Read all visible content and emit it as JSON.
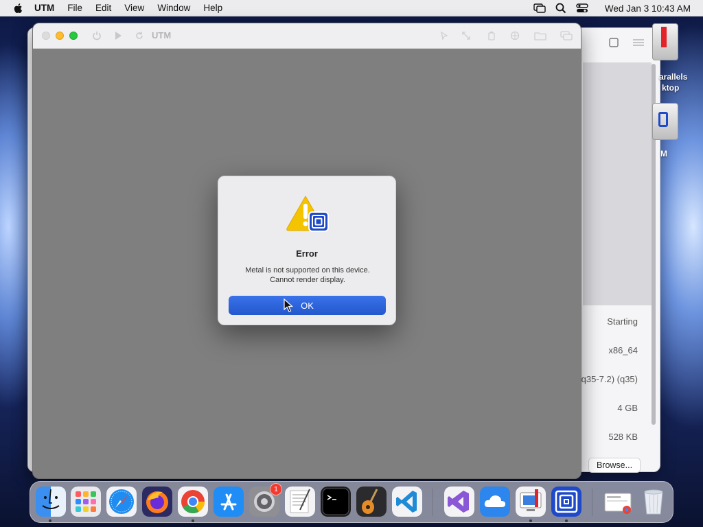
{
  "menubar": {
    "app_name": "UTM",
    "items": [
      "File",
      "Edit",
      "View",
      "Window",
      "Help"
    ],
    "clock": "Wed Jan 3  10:43 AM"
  },
  "utm_window": {
    "title": "UTM"
  },
  "background_window": {
    "desktop_labels": [
      "arallels",
      "ktop",
      "M"
    ],
    "info": {
      "status": "Starting",
      "architecture": "x86_64",
      "machine": "q35-7.2) (q35)",
      "memory": "4 GB",
      "size": "528 KB"
    },
    "browse_label": "Browse..."
  },
  "alert": {
    "title": "Error",
    "message_line1": "Metal is not supported on this device.",
    "message_line2": "Cannot render display.",
    "ok_label": "OK"
  },
  "dock": {
    "apps": [
      "finder-icon",
      "launchpad-icon",
      "safari-icon",
      "firefox-icon",
      "chrome-icon",
      "app-store-icon",
      "system-settings-icon",
      "textedit-icon",
      "terminal-icon",
      "garageband-icon",
      "vscode-icon",
      "visual-studio-icon",
      "icloud-icon",
      "remote-desktop-icon",
      "utm-icon",
      "downloads-stack-icon",
      "trash-icon"
    ],
    "settings_badge": "1"
  },
  "colors": {
    "accent": "#2860d8",
    "warning": "#f5c400",
    "utm_blue": "#1e49c9"
  }
}
